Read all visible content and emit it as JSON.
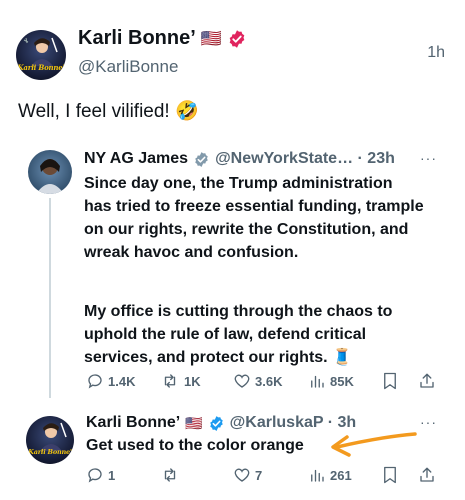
{
  "main_post": {
    "author_name": "Karli Bonne’",
    "flag": "🇺🇸",
    "handle": "@KarliBonne",
    "time": "1h",
    "text": "Well, I feel vilified! 🤣",
    "avatar_text": "Karli Bonne'",
    "verified_color": "#e0245e"
  },
  "quoted_post": {
    "author_name": "NY AG James",
    "handle_time": "@NewYorkState… · 23h",
    "more": "···",
    "paragraph1": "Since day one, the Trump administration has tried to freeze essential funding, trample on our rights, rewrite the Constitution, and wreak havoc and confusion.",
    "paragraph2": "My office is cutting through the chaos to uphold the rule of law, defend critical services, and protect our rights. 🧵",
    "verified_color": "#829aab",
    "actions": {
      "replies": "1.4K",
      "reposts": "1K",
      "likes": "3.6K",
      "views": "85K"
    }
  },
  "reply_post": {
    "author_name": "Karli Bonne’",
    "flag": "🇺🇸",
    "handle_time": "@KarluskaP · 3h",
    "more": "···",
    "text": "Get used to the color orange",
    "avatar_text": "Karli Bonne'",
    "verified_color": "#1d9bf0",
    "actions": {
      "replies": "1",
      "reposts": "",
      "likes": "7",
      "views": "261"
    },
    "annotation_color": "#f39a1e"
  }
}
